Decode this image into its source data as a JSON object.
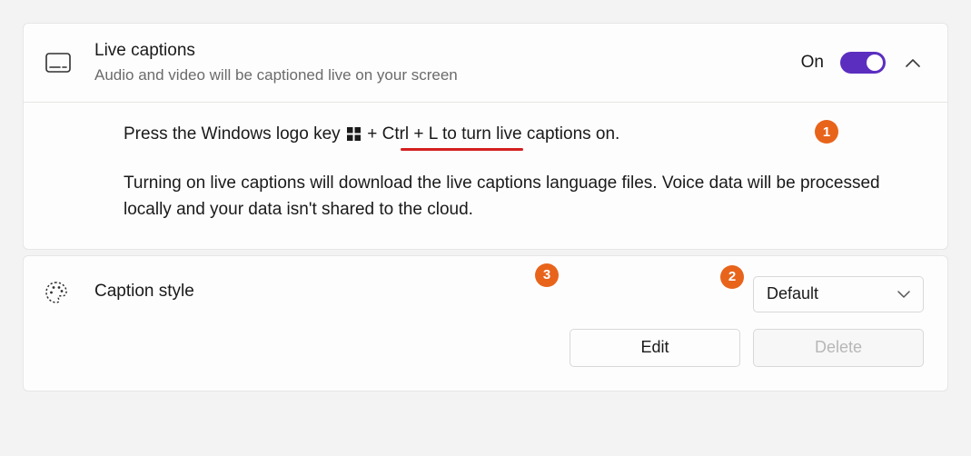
{
  "live_captions": {
    "title": "Live captions",
    "subtitle": "Audio and video will be captioned live on your screen",
    "state_label": "On",
    "toggle_on": true,
    "shortcut_prefix": "Press the Windows logo key ",
    "shortcut_combo": " + Ctrl + L",
    "shortcut_suffix": " to turn live captions on.",
    "paragraph2": "Turning on live captions will download the live captions language files. Voice data will be processed locally and your data isn't shared to the cloud."
  },
  "caption_style": {
    "label": "Caption style",
    "select_value": "Default",
    "edit_label": "Edit",
    "delete_label": "Delete"
  },
  "annotations": {
    "n1": "1",
    "n2": "2",
    "n3": "3"
  }
}
